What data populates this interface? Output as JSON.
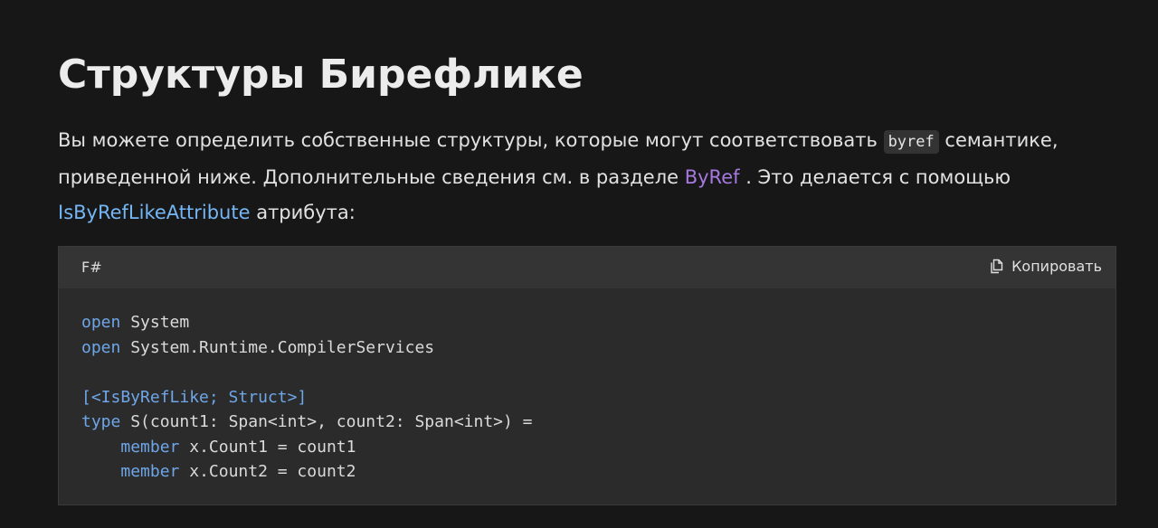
{
  "title": "Структуры Бирефлике",
  "intro": {
    "part1": "Вы можете определить собственные структуры, которые могут соответствовать ",
    "code": "byref",
    "part2": " семантике, приведенной ниже. Дополнительные сведения см. в разделе ",
    "link1": "ByRef",
    "part3": " . Это делается с помощью ",
    "link2": "IsByRefLikeAttribute",
    "part4": " атрибута:"
  },
  "code_block": {
    "language": "F#",
    "copy_label": "Копировать",
    "lines": {
      "l1_kw": "open",
      "l1_rest": " System",
      "l2_kw": "open",
      "l2_rest": " System.Runtime.CompilerServices",
      "l4_attr": "[<IsByRefLike; Struct>]",
      "l5_kw": "type",
      "l5_rest": " S(count1: Span<int>, count2: Span<int>) =",
      "l6_indent": "    ",
      "l6_kw": "member",
      "l6_rest": " x.Count1 = count1",
      "l7_indent": "    ",
      "l7_kw": "member",
      "l7_rest": " x.Count2 = count2"
    }
  },
  "colors": {
    "background": "#171717",
    "code_background": "#2b2b2b",
    "keyword": "#6ea6e8",
    "link_purple": "#a579e0",
    "link_blue": "#75b6f5"
  },
  "icons": {
    "copy": "copy-icon"
  }
}
